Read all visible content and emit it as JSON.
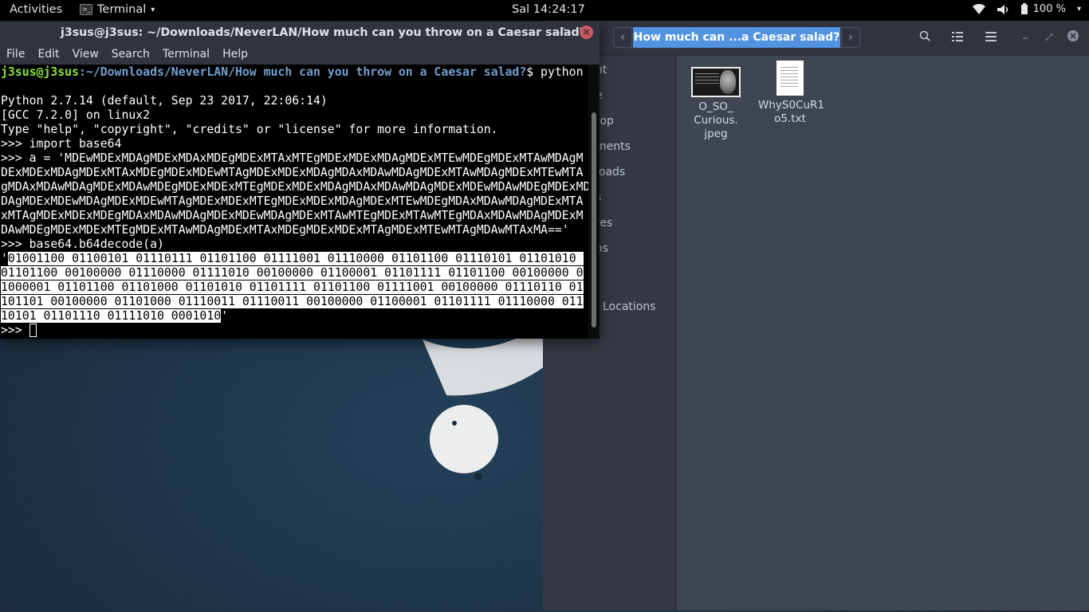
{
  "topbar": {
    "activities": "Activities",
    "app_name": "Terminal",
    "clock": "Sal 14:24:17",
    "battery": "100 %",
    "icons": [
      "wifi-icon",
      "volume-icon",
      "battery-icon",
      "power-icon"
    ]
  },
  "terminal": {
    "title": "j3sus@j3sus: ~/Downloads/NeverLAN/How much can you throw on a Caesar salad?",
    "menu": [
      "File",
      "Edit",
      "View",
      "Search",
      "Terminal",
      "Help"
    ],
    "prompt_user": "j3sus@j3sus",
    "prompt_path": ":~/Downloads/NeverLAN/How much can you throw on a Caesar salad?",
    "prompt_cmd": "$ python",
    "lines": [
      "Python 2.7.14 (default, Sep 23 2017, 22:06:14)",
      "[GCC 7.2.0] on linux2",
      "Type \"help\", \"copyright\", \"credits\" or \"license\" for more information.",
      ">>> import base64",
      ">>> a = 'MDEwMDExMDAgMDExMDAxMDEgMDExMTAxMTEgMDExMDExMDAgMDExMTEwMDEgMDExMTAwMDAgM",
      "DExMDExMDAgMDExMTAxMDEgMDExMDEwMTAgMDExMDExMDAgMDAxMDAwMDAgMDExMTAwMDAgMDExMTEwMTA",
      "gMDAxMDAwMDAgMDExMDAwMDEgMDExMDExMTEgMDExMDExMDAgMDAxMDAwMDAgMDExMDEwMDAwMDEgMDExMDExM",
      "DAgMDExMDEwMDAgMDExMDEwMTAgMDExMDExMTEgMDExMDExMDAgMDExMTEwMDEgMDAxMDAwMDAgMDExMTA",
      "xMTAgMDExMDExMDEgMDAxMDAwMDAgMDExMDEwMDAgMDExMTAwMTEgMDExMTAwMTEgMDAxMDAwMDAgMDExM",
      "DAwMDEgMDExMDExMTEgMDExMTAwMDAgMDExMTAxMDEgMDExMDExMTAgMDExMTEwMTAgMDAwMTAxMA=='",
      ">>> base64.b64decode(a)"
    ],
    "output_lines": [
      "01001100 01100101 01110111 01101100 01111001 01110000 01101100 01110101 01101010 ",
      "01101100 00100000 01110000 01111010 00100000 01100001 01101111 01101100 00100000 0",
      "1000001 01101100 01101000 01101010 01101111 01101100 01111001 00100000 01110110 01",
      "101101 00100000 01101000 01110011 01110011 00100000 01100001 01101111 01110000 011",
      "10101 01101110 01111010 0001010"
    ],
    "final_prompt": ">>> "
  },
  "files": {
    "path_label": "How much can ...a Caesar salad?",
    "sidebar": [
      {
        "label": "nt"
      },
      {
        "label": "e"
      },
      {
        "label": "top"
      },
      {
        "label": "ments"
      },
      {
        "label": "loads"
      },
      {
        "label": "s"
      },
      {
        "label": "res"
      },
      {
        "label": "os"
      },
      {
        "label": "Locations"
      }
    ],
    "items": [
      {
        "name_lines": [
          "O_SO_",
          "Curious.",
          "jpeg"
        ],
        "icon": "image-file-icon"
      },
      {
        "name_lines": [
          "WhyS0CuR1",
          "o5.txt"
        ],
        "icon": "text-file-icon"
      }
    ]
  }
}
